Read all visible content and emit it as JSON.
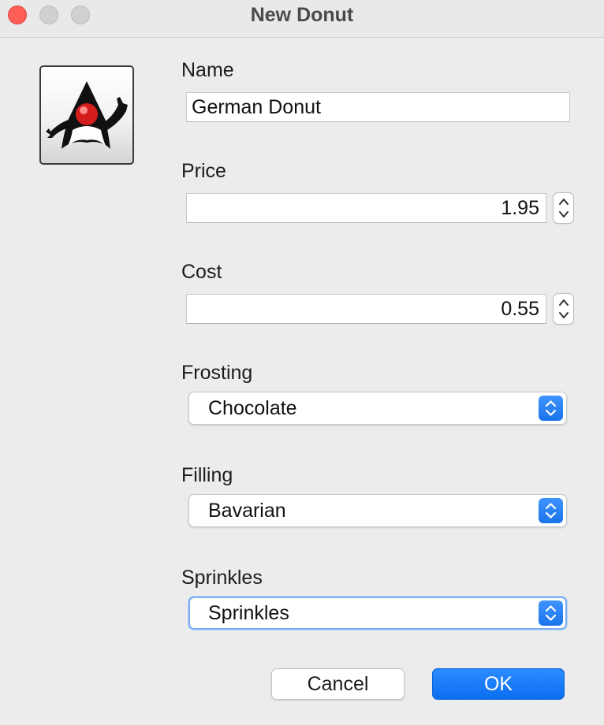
{
  "window": {
    "title": "New Donut"
  },
  "fields": {
    "name": {
      "label": "Name",
      "value": "German Donut"
    },
    "price": {
      "label": "Price",
      "value": "1.95"
    },
    "cost": {
      "label": "Cost",
      "value": "0.55"
    },
    "frosting": {
      "label": "Frosting",
      "value": "Chocolate"
    },
    "filling": {
      "label": "Filling",
      "value": "Bavarian"
    },
    "sprinkles": {
      "label": "Sprinkles",
      "value": "Sprinkles"
    }
  },
  "buttons": {
    "cancel": "Cancel",
    "ok": "OK"
  },
  "icons": {
    "logo": "duke-mascot-icon",
    "stepper": "stepper-arrows-icon",
    "select": "select-arrows-icon"
  },
  "colors": {
    "accent": "#1a73ea",
    "close_button": "#ff5f57",
    "window_background": "#ececec"
  }
}
